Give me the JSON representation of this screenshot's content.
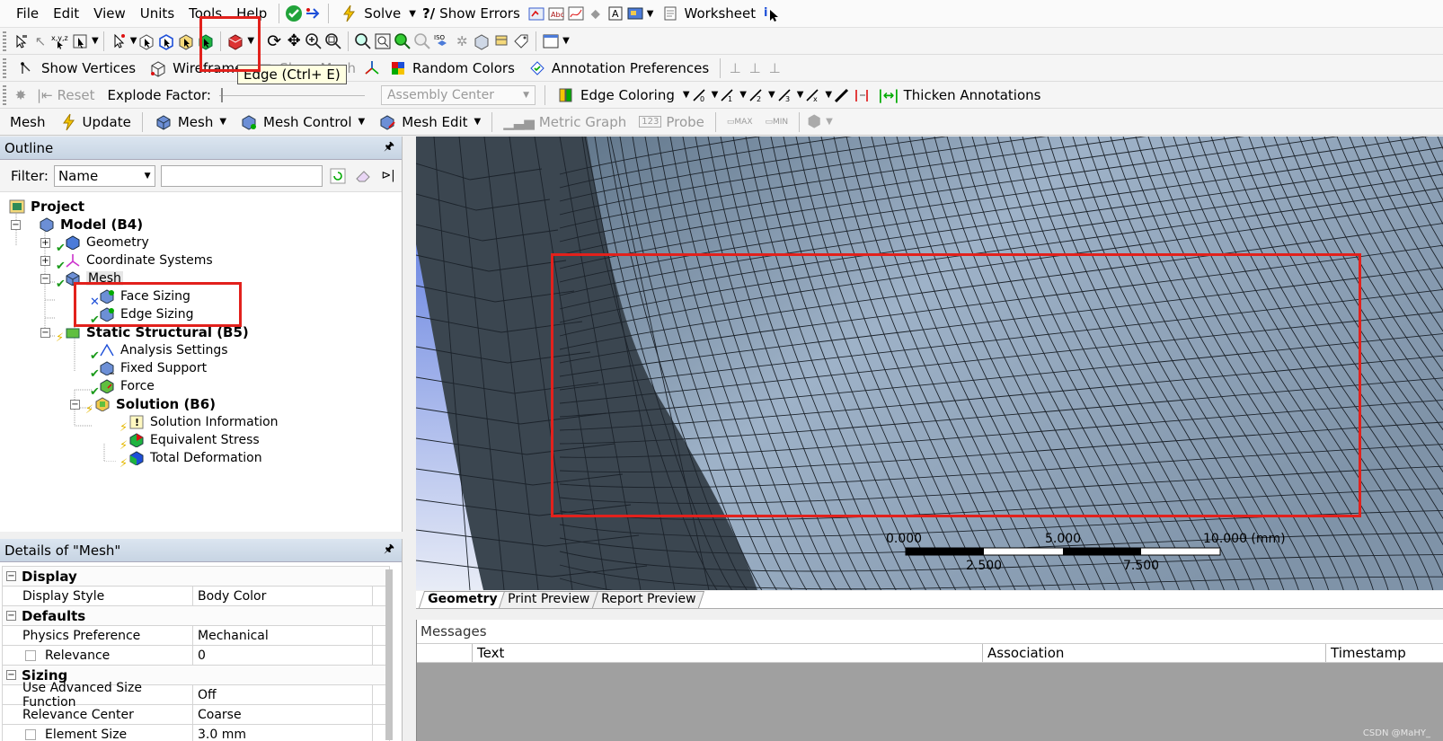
{
  "menu": [
    "File",
    "Edit",
    "View",
    "Units",
    "Tools",
    "Help"
  ],
  "toolbar1": {
    "solve": "Solve",
    "show_errors": "Show Errors",
    "worksheet": "Worksheet"
  },
  "toolbar3": {
    "show_vertices": "Show Vertices",
    "wireframe": "Wireframe",
    "show_mesh": "Show Mesh",
    "random_colors": "Random Colors",
    "annotation_preferences": "Annotation Preferences"
  },
  "toolbar4": {
    "reset": "Reset",
    "explode_factor": "Explode Factor:",
    "assembly_center": "Assembly Center",
    "edge_coloring": "Edge Coloring",
    "thicken_annotations": "Thicken Annotations"
  },
  "toolbar5": {
    "context": "Mesh",
    "update": "Update",
    "mesh": "Mesh",
    "mesh_control": "Mesh Control",
    "mesh_edit": "Mesh Edit",
    "metric_graph": "Metric Graph",
    "probe": "Probe"
  },
  "tooltip": "Edge (Ctrl+ E)",
  "outline": {
    "title": "Outline",
    "filter_label": "Filter:",
    "filter_value": "Name",
    "tree": [
      {
        "label": "Project",
        "indent": 0,
        "bold": true
      },
      {
        "label": "Model (B4)",
        "indent": 1,
        "bold": true
      },
      {
        "label": "Geometry",
        "indent": 2
      },
      {
        "label": "Coordinate Systems",
        "indent": 2
      },
      {
        "label": "Mesh",
        "indent": 2
      },
      {
        "label": "Face Sizing",
        "indent": 3
      },
      {
        "label": "Edge Sizing",
        "indent": 3
      },
      {
        "label": "Static Structural (B5)",
        "indent": 2,
        "bold": true
      },
      {
        "label": "Analysis Settings",
        "indent": 3
      },
      {
        "label": "Fixed Support",
        "indent": 3
      },
      {
        "label": "Force",
        "indent": 3
      },
      {
        "label": "Solution (B6)",
        "indent": 3,
        "bold": true
      },
      {
        "label": "Solution Information",
        "indent": 4
      },
      {
        "label": "Equivalent Stress",
        "indent": 4
      },
      {
        "label": "Total Deformation",
        "indent": 4
      }
    ]
  },
  "details": {
    "title": "Details of \"Mesh\"",
    "sections": [
      {
        "name": "Display",
        "rows": [
          {
            "label": "Display Style",
            "value": "Body Color"
          }
        ]
      },
      {
        "name": "Defaults",
        "rows": [
          {
            "label": "Physics Preference",
            "value": "Mechanical"
          },
          {
            "label": "Relevance",
            "value": "0"
          }
        ]
      },
      {
        "name": "Sizing",
        "rows": [
          {
            "label": "Use Advanced Size Function",
            "value": "Off"
          },
          {
            "label": "Relevance Center",
            "value": "Coarse"
          },
          {
            "label": "Element Size",
            "value": "3.0 mm"
          }
        ]
      }
    ]
  },
  "scale_bar": {
    "top_labels": [
      "0.000",
      "5.000",
      "10.000 (mm)"
    ],
    "bottom_labels": [
      "2.500",
      "7.500"
    ]
  },
  "view_tabs": [
    "Geometry",
    "Print Preview",
    "Report Preview"
  ],
  "messages": {
    "title": "Messages",
    "columns": [
      "Text",
      "Association",
      "Timestamp"
    ]
  },
  "watermark": "CSDN @MaHY_",
  "colors": {
    "panel_header": "#c7d4e3",
    "highlight": "#e2211c",
    "mesh_face": "#7f93a8",
    "mesh_dark": "#3b4650"
  }
}
